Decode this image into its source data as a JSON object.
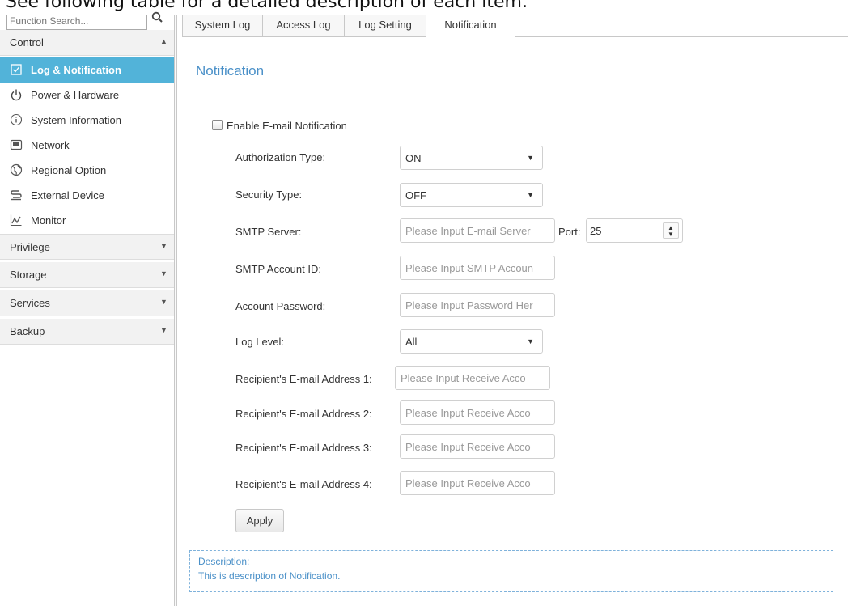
{
  "caption": "See following table for a detailed description of each item.",
  "search": {
    "placeholder": "Function Search..."
  },
  "sidebar": {
    "control_label": "Control",
    "items": [
      {
        "label": "Log & Notification"
      },
      {
        "label": "Power & Hardware"
      },
      {
        "label": "System Information"
      },
      {
        "label": "Network"
      },
      {
        "label": "Regional Option"
      },
      {
        "label": "External Device"
      },
      {
        "label": "Monitor"
      }
    ],
    "groups": [
      {
        "label": "Privilege"
      },
      {
        "label": "Storage"
      },
      {
        "label": "Services"
      },
      {
        "label": "Backup"
      }
    ]
  },
  "tabs": [
    {
      "label": "System Log"
    },
    {
      "label": "Access Log"
    },
    {
      "label": "Log Setting"
    },
    {
      "label": "Notification"
    }
  ],
  "main": {
    "title": "Notification",
    "enable_label": "Enable E-mail Notification",
    "auth_label": "Authorization Type:",
    "auth_value": "ON",
    "security_label": "Security Type:",
    "security_value": "OFF",
    "smtp_label": "SMTP Server:",
    "smtp_placeholder": "Please Input E-mail Server",
    "port_label": "Port:",
    "port_value": "25",
    "account_label": "SMTP Account ID:",
    "account_placeholder": "Please Input SMTP Accoun",
    "password_label": "Account Password:",
    "password_placeholder": "Please Input Password Her",
    "loglevel_label": "Log Level:",
    "loglevel_value": "All",
    "recipients": [
      {
        "label": "Recipient's E-mail Address 1:",
        "placeholder": "Please Input Receive Acco"
      },
      {
        "label": "Recipient's E-mail Address 2:",
        "placeholder": "Please Input Receive Acco"
      },
      {
        "label": "Recipient's E-mail Address 3:",
        "placeholder": "Please Input Receive Acco"
      },
      {
        "label": "Recipient's E-mail Address 4:",
        "placeholder": "Please Input Receive Acco"
      }
    ],
    "apply_label": "Apply",
    "desc_title": "Description:",
    "desc_text": "This is description of Notification."
  },
  "colors": {
    "accent": "#52b3d9",
    "link": "#4a90c8"
  },
  "icons": [
    "search-icon",
    "log-notification-icon",
    "power-icon",
    "info-icon",
    "network-icon",
    "globe-icon",
    "external-device-icon",
    "monitor-icon",
    "chevron-up-icon",
    "chevron-down-icon"
  ]
}
